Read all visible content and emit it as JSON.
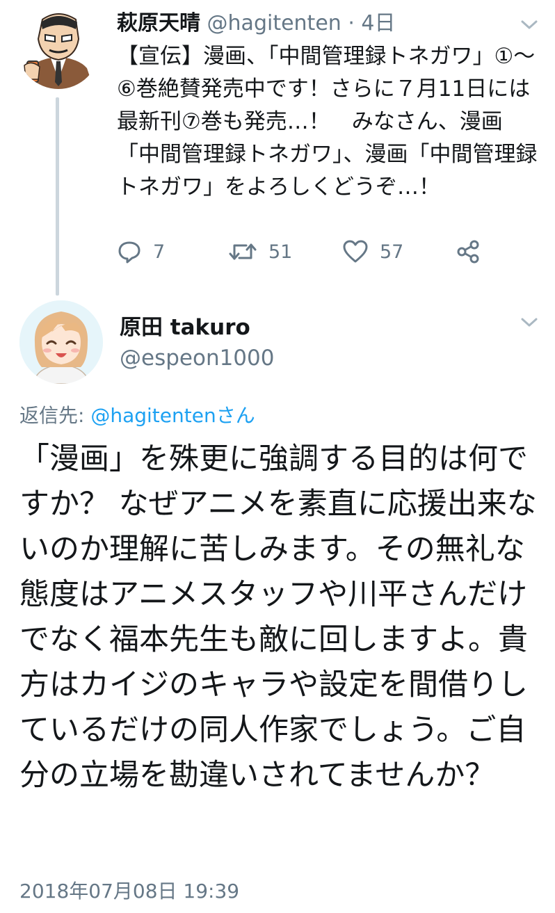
{
  "tweet1": {
    "display_name": "萩原天晴",
    "handle": "@hagitenten",
    "separator": " · ",
    "time_ago": "4日",
    "text": "【宣伝】漫画、「中間管理録トネガワ」①〜⑥巻絶賛発売中です！さらに７月11日には最新刊⑦巻も発売…！　みなさん、漫画「中間管理録トネガワ」、漫画「中間管理録トネガワ」をよろしくどうぞ…！",
    "replies": "7",
    "retweets": "51",
    "likes": "57",
    "menu_icon": "chevron-down-icon"
  },
  "tweet2": {
    "display_name": "原田 takuro",
    "handle": "@espeon1000",
    "reply_prefix": "返信先: ",
    "reply_mention": "@hagitenten",
    "reply_suffix": "さん",
    "text": "「漫画」を殊更に強調する目的は何ですか？ なぜアニメを素直に応援出来ないのか理解に苦しみます。その無礼な態度はアニメスタッフや川平さんだけでなく福本先生も敵に回しますよ。貴方はカイジのキャラや設定を間借りしているだけの同人作家でしょう。ご自分の立場を勘違いされてませんか？",
    "timestamp": "2018年07月08日 19:39",
    "menu_icon": "chevron-down-icon"
  },
  "colors": {
    "primary_text": "#14171a",
    "secondary_text": "#657786",
    "link": "#1da1f2",
    "thread_line": "#ccd6dd"
  }
}
